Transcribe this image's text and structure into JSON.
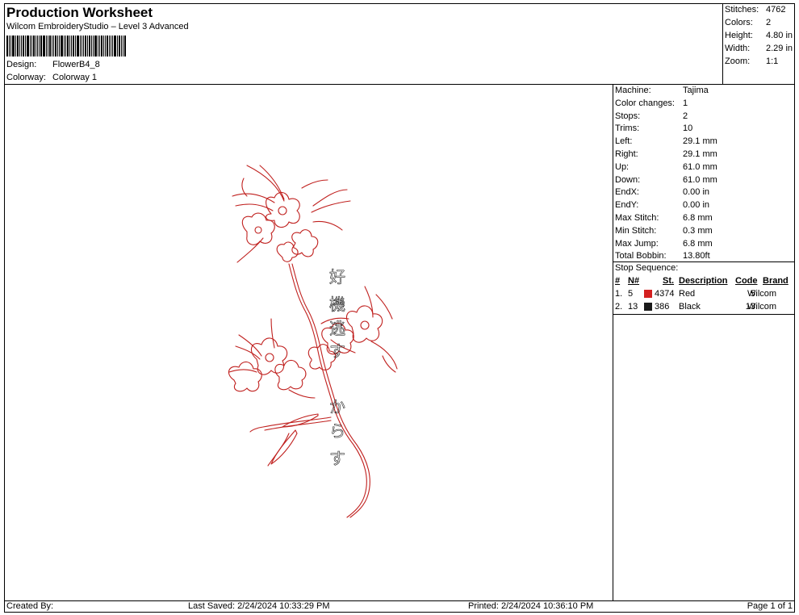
{
  "header": {
    "title": "Production Worksheet",
    "subtitle": "Wilcom EmbroideryStudio – Level 3 Advanced",
    "design_label": "Design:",
    "design_value": "FlowerB4_8",
    "colorway_label": "Colorway:",
    "colorway_value": "Colorway 1"
  },
  "stats": {
    "stitches_label": "Stitches:",
    "stitches": "4762",
    "colors_label": "Colors:",
    "colors": "2",
    "height_label": "Height:",
    "height": "4.80 in",
    "width_label": "Width:",
    "width": "2.29 in",
    "zoom_label": "Zoom:",
    "zoom": "1:1"
  },
  "properties": [
    {
      "label": "Machine:",
      "value": "Tajima"
    },
    {
      "label": "Color changes:",
      "value": "1"
    },
    {
      "label": "Stops:",
      "value": "2"
    },
    {
      "label": "Trims:",
      "value": "10"
    },
    {
      "label": "Left:",
      "value": "29.1 mm"
    },
    {
      "label": "Right:",
      "value": "29.1 mm"
    },
    {
      "label": "Up:",
      "value": "61.0 mm"
    },
    {
      "label": "Down:",
      "value": "61.0 mm"
    },
    {
      "label": "EndX:",
      "value": "0.00 in"
    },
    {
      "label": "EndY:",
      "value": "0.00 in"
    },
    {
      "label": "Max Stitch:",
      "value": "6.8 mm"
    },
    {
      "label": "Min Stitch:",
      "value": "0.3 mm"
    },
    {
      "label": "Max Jump:",
      "value": "6.8 mm"
    },
    {
      "label": "Total Bobbin:",
      "value": "13.80ft"
    }
  ],
  "stop_sequence": {
    "title": "Stop Sequence:",
    "columns": {
      "num": "#",
      "n": "N#",
      "st": "St.",
      "desc": "Description",
      "code": "Code",
      "brand": "Brand"
    },
    "rows": [
      {
        "num": "1.",
        "n": "5",
        "color": "#d42020",
        "st": "4374",
        "desc": "Red",
        "code": "5",
        "brand": "Wilcom"
      },
      {
        "num": "2.",
        "n": "13",
        "color": "#1a1a1a",
        "st": "386",
        "desc": "Black",
        "code": "13",
        "brand": "Wilcom"
      }
    ]
  },
  "design": {
    "thread_red": "#c0201e",
    "thread_black": "#222222",
    "kanji_chars": [
      "好",
      "機",
      "逃",
      "す",
      "か",
      "ら",
      "す"
    ]
  },
  "footer": {
    "created_by": "Created By:",
    "last_saved": "Last Saved: 2/24/2024 10:33:29 PM",
    "printed": "Printed: 2/24/2024 10:36:10 PM",
    "page": "Page 1 of 1"
  }
}
